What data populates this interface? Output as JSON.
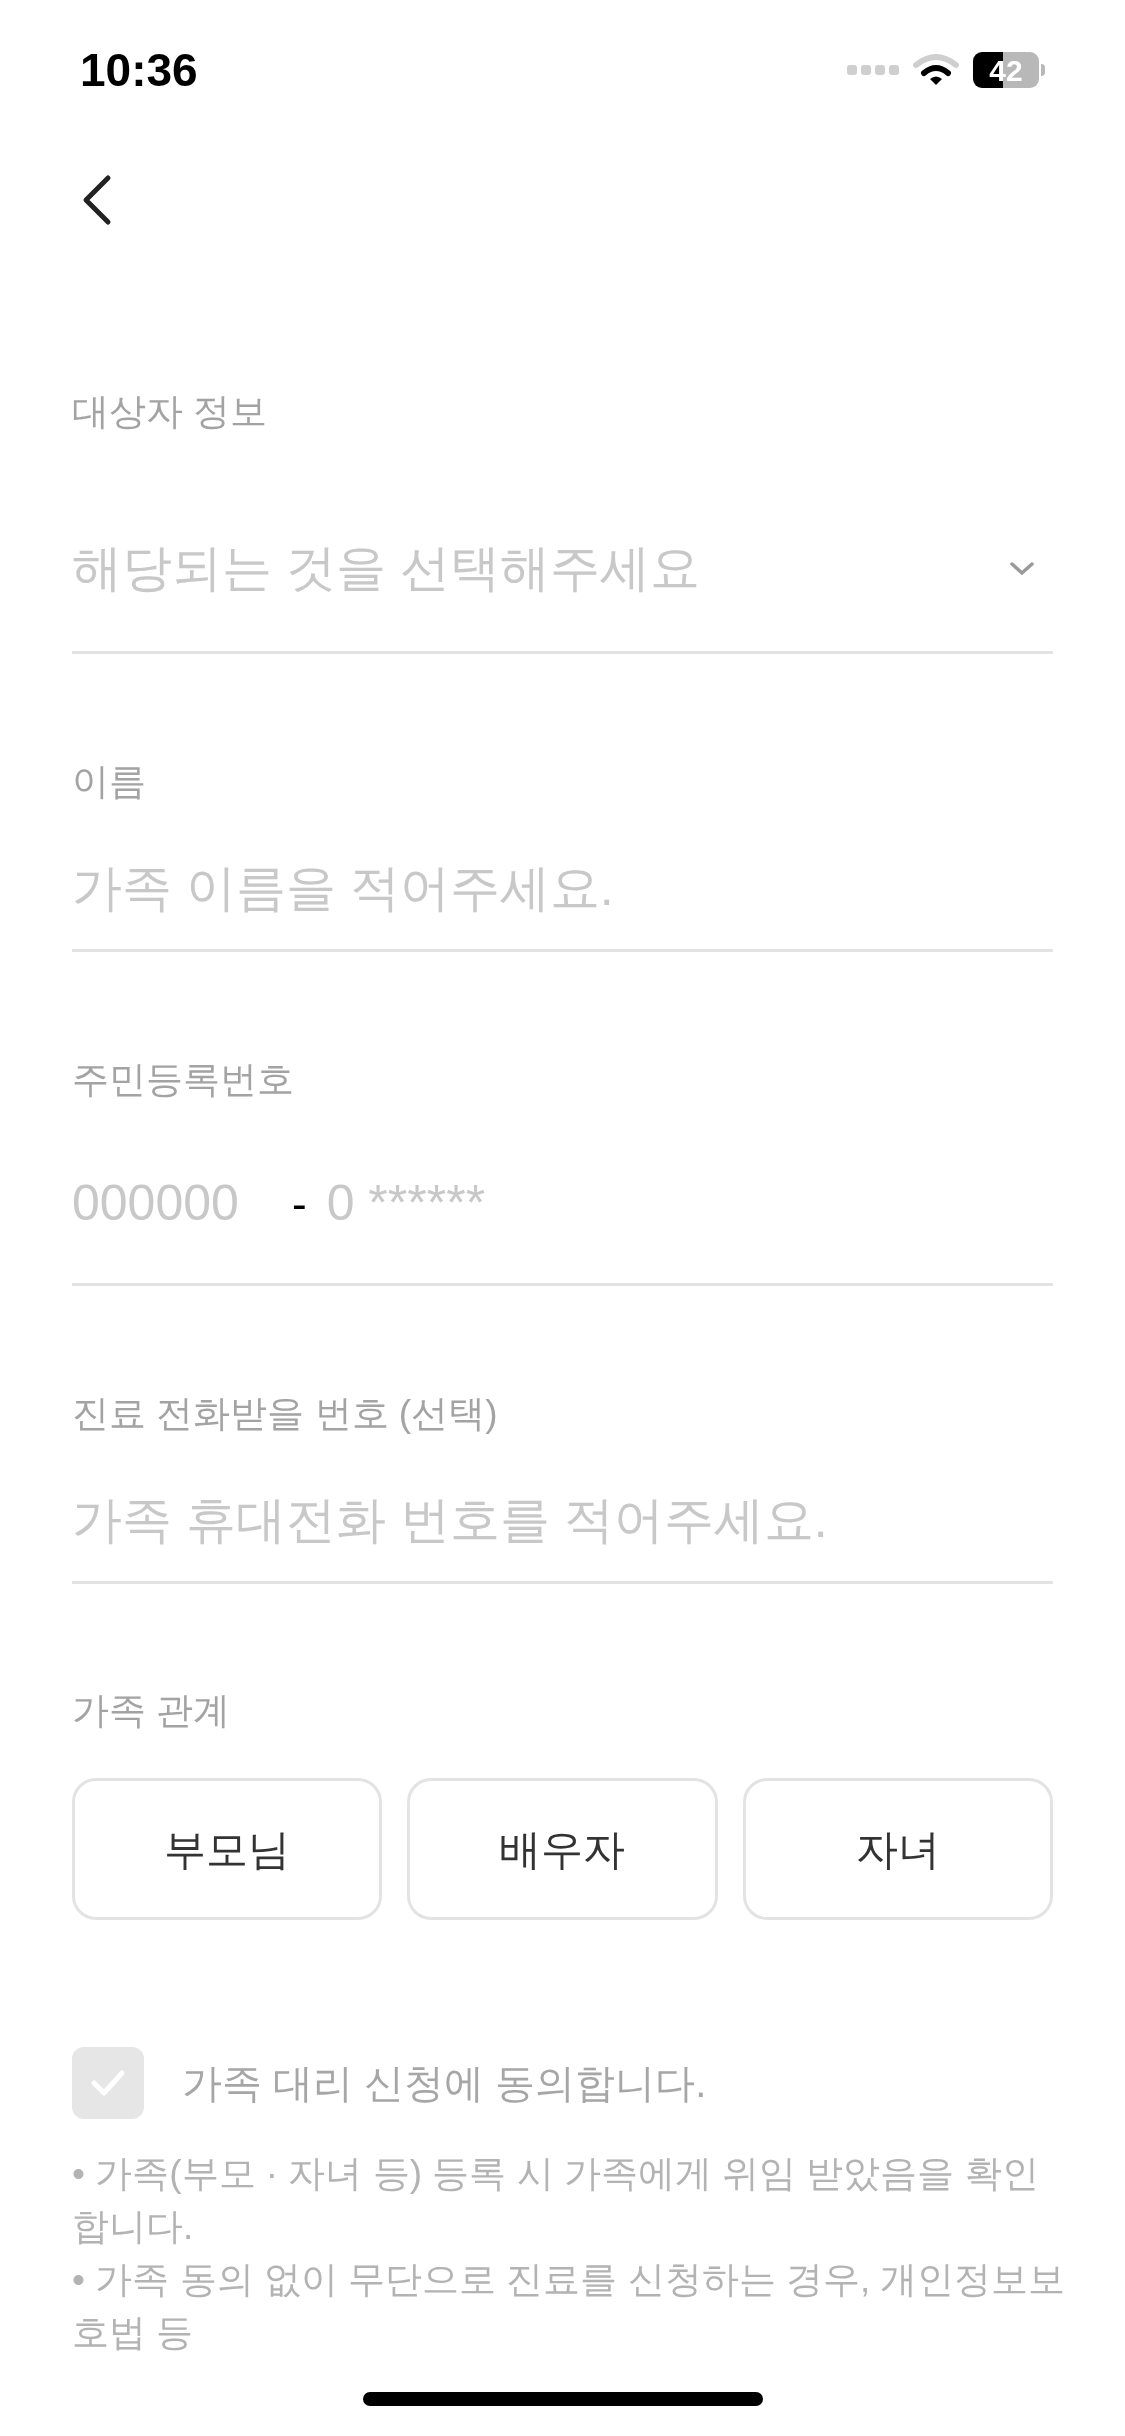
{
  "status_bar": {
    "time": "10:36",
    "battery": "42"
  },
  "sections": [
    {
      "kind": "select",
      "label": "대상자 정보",
      "placeholder": "해당되는 것을 선택해주세요"
    },
    {
      "kind": "text",
      "label": "이름",
      "placeholder": "가족 이름을 적어주세요."
    },
    {
      "kind": "rrn",
      "label": "주민등록번호",
      "front_placeholder": "000000",
      "separator": "-",
      "back_placeholder": "0 ******"
    },
    {
      "kind": "text",
      "label": "진료 전화받을 번호 (선택)",
      "placeholder": "가족 휴대전화 번호를 적어주세요."
    }
  ],
  "relationship": {
    "label": "가족 관계",
    "options": [
      {
        "label": "부모님",
        "selected": false
      },
      {
        "label": "배우자",
        "selected": false
      },
      {
        "label": "자녀",
        "selected": false
      }
    ]
  },
  "consent": {
    "label": "가족 대리 신청에 동의합니다.",
    "checked": false
  },
  "notices": [
    "• 가족(부모 · 자녀 등) 등록 시 가족에게 위임 받았음을 확인합니다.",
    "• 가족 동의 없이 무단으로 진료를 신청하는 경우, 개인정보보호법 등"
  ]
}
